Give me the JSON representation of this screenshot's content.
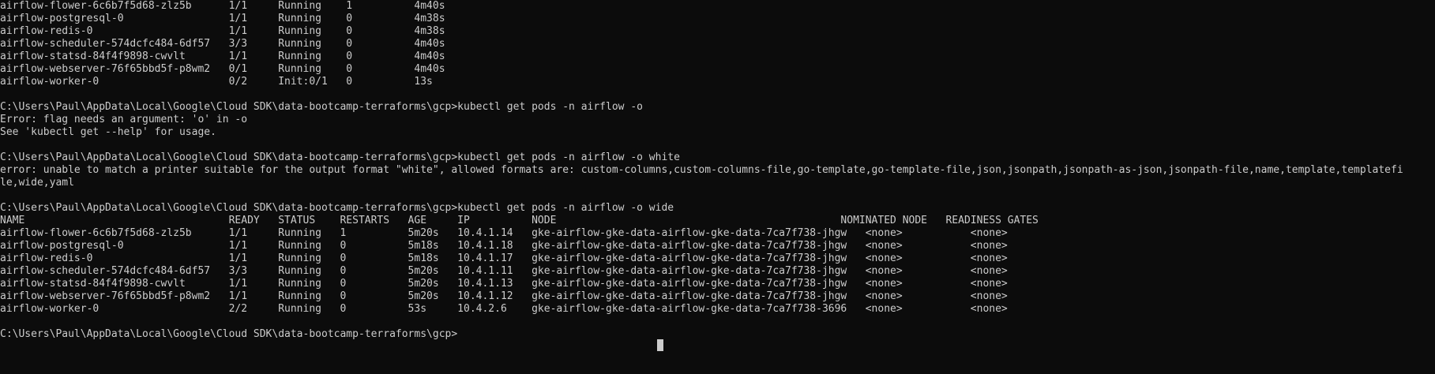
{
  "terminal": {
    "lines": [
      "airflow-flower-6c6b7f5d68-zlz5b      1/1     Running    1          4m40s",
      "airflow-postgresql-0                 1/1     Running    0          4m38s",
      "airflow-redis-0                      1/1     Running    0          4m38s",
      "airflow-scheduler-574dcfc484-6df57   3/3     Running    0          4m40s",
      "airflow-statsd-84f4f9898-cwvlt       1/1     Running    0          4m40s",
      "airflow-webserver-76f65bbd5f-p8wm2   0/1     Running    0          4m40s",
      "airflow-worker-0                     0/2     Init:0/1   0          13s",
      "",
      "C:\\Users\\Paul\\AppData\\Local\\Google\\Cloud SDK\\data-bootcamp-terraforms\\gcp>kubectl get pods -n airflow -o",
      "Error: flag needs an argument: 'o' in -o",
      "See 'kubectl get --help' for usage.",
      "",
      "C:\\Users\\Paul\\AppData\\Local\\Google\\Cloud SDK\\data-bootcamp-terraforms\\gcp>kubectl get pods -n airflow -o white",
      "error: unable to match a printer suitable for the output format \"white\", allowed formats are: custom-columns,custom-columns-file,go-template,go-template-file,json,jsonpath,jsonpath-as-json,jsonpath-file,name,template,templatefi",
      "le,wide,yaml",
      "",
      "C:\\Users\\Paul\\AppData\\Local\\Google\\Cloud SDK\\data-bootcamp-terraforms\\gcp>kubectl get pods -n airflow -o wide",
      "NAME                                 READY   STATUS    RESTARTS   AGE     IP          NODE                                              NOMINATED NODE   READINESS GATES",
      "airflow-flower-6c6b7f5d68-zlz5b      1/1     Running   1          5m20s   10.4.1.14   gke-airflow-gke-data-airflow-gke-data-7ca7f738-jhgw   <none>           <none>",
      "airflow-postgresql-0                 1/1     Running   0          5m18s   10.4.1.18   gke-airflow-gke-data-airflow-gke-data-7ca7f738-jhgw   <none>           <none>",
      "airflow-redis-0                      1/1     Running   0          5m18s   10.4.1.17   gke-airflow-gke-data-airflow-gke-data-7ca7f738-jhgw   <none>           <none>",
      "airflow-scheduler-574dcfc484-6df57   3/3     Running   0          5m20s   10.4.1.11   gke-airflow-gke-data-airflow-gke-data-7ca7f738-jhgw   <none>           <none>",
      "airflow-statsd-84f4f9898-cwvlt       1/1     Running   0          5m20s   10.4.1.13   gke-airflow-gke-data-airflow-gke-data-7ca7f738-jhgw   <none>           <none>",
      "airflow-webserver-76f65bbd5f-p8wm2   1/1     Running   0          5m20s   10.4.1.12   gke-airflow-gke-data-airflow-gke-data-7ca7f738-jhgw   <none>           <none>",
      "airflow-worker-0                     2/2     Running   0          53s     10.4.2.6    gke-airflow-gke-data-airflow-gke-data-7ca7f738-3696   <none>           <none>",
      "",
      "C:\\Users\\Paul\\AppData\\Local\\Google\\Cloud SDK\\data-bootcamp-terraforms\\gcp>"
    ]
  },
  "colors": {
    "background": "#0c0c0c",
    "foreground": "#cccccc"
  }
}
